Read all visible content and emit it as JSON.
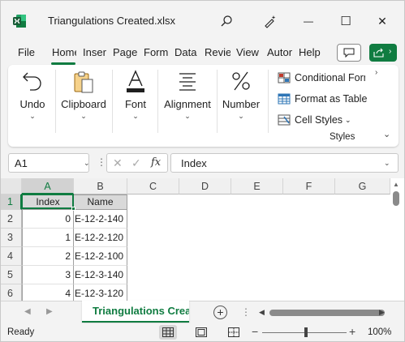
{
  "window": {
    "title": "Triangulations Created.xlsx",
    "minimize_glyph": "—",
    "maximize_glyph": "☐",
    "close_glyph": "✕"
  },
  "menu": {
    "items": [
      {
        "label": "File"
      },
      {
        "label": "Home"
      },
      {
        "label": "Insert"
      },
      {
        "label": "Page"
      },
      {
        "label": "Formulas"
      },
      {
        "label": "Data"
      },
      {
        "label": "Review"
      },
      {
        "label": "View"
      },
      {
        "label": "Automate"
      },
      {
        "label": "Help"
      }
    ],
    "active_index": 1
  },
  "ribbon": {
    "groups": [
      {
        "label": "Undo",
        "icon": "undo-icon"
      },
      {
        "label": "Clipboard",
        "icon": "clipboard-icon"
      },
      {
        "label": "Font",
        "icon": "font-icon"
      },
      {
        "label": "Alignment",
        "icon": "alignment-icon"
      },
      {
        "label": "Number",
        "icon": "percent-icon"
      }
    ],
    "chevron": "⌄",
    "styles": {
      "items": [
        {
          "label": "Conditional Formatting",
          "icon": "conditional-formatting-icon"
        },
        {
          "label": "Format as Table",
          "icon": "format-table-icon"
        },
        {
          "label": "Cell Styles",
          "icon": "cell-styles-icon"
        }
      ],
      "group_label": "Styles"
    }
  },
  "formula_bar": {
    "name_box": "A1",
    "formula": "Index",
    "fx": "fx",
    "cancel": "✕",
    "confirm": "✓"
  },
  "grid": {
    "columns": [
      "A",
      "B",
      "C",
      "D",
      "E",
      "F",
      "G"
    ],
    "row_numbers": [
      "1",
      "2",
      "3",
      "4",
      "5",
      "6"
    ],
    "header_row": [
      "Index",
      "Name"
    ],
    "rows": [
      {
        "index": "0",
        "name": "E-12-2-140"
      },
      {
        "index": "1",
        "name": "E-12-2-120"
      },
      {
        "index": "2",
        "name": "E-12-2-100"
      },
      {
        "index": "3",
        "name": "E-12-3-140"
      },
      {
        "index": "4",
        "name": "E-12-3-120"
      }
    ]
  },
  "sheets": {
    "tabs": [
      {
        "label": "Triangulations Created"
      }
    ],
    "add_glyph": "+"
  },
  "status": {
    "text": "Ready",
    "zoom": "100%",
    "zoom_minus": "−",
    "zoom_plus": "+"
  },
  "colors": {
    "accent": "#107c41"
  }
}
